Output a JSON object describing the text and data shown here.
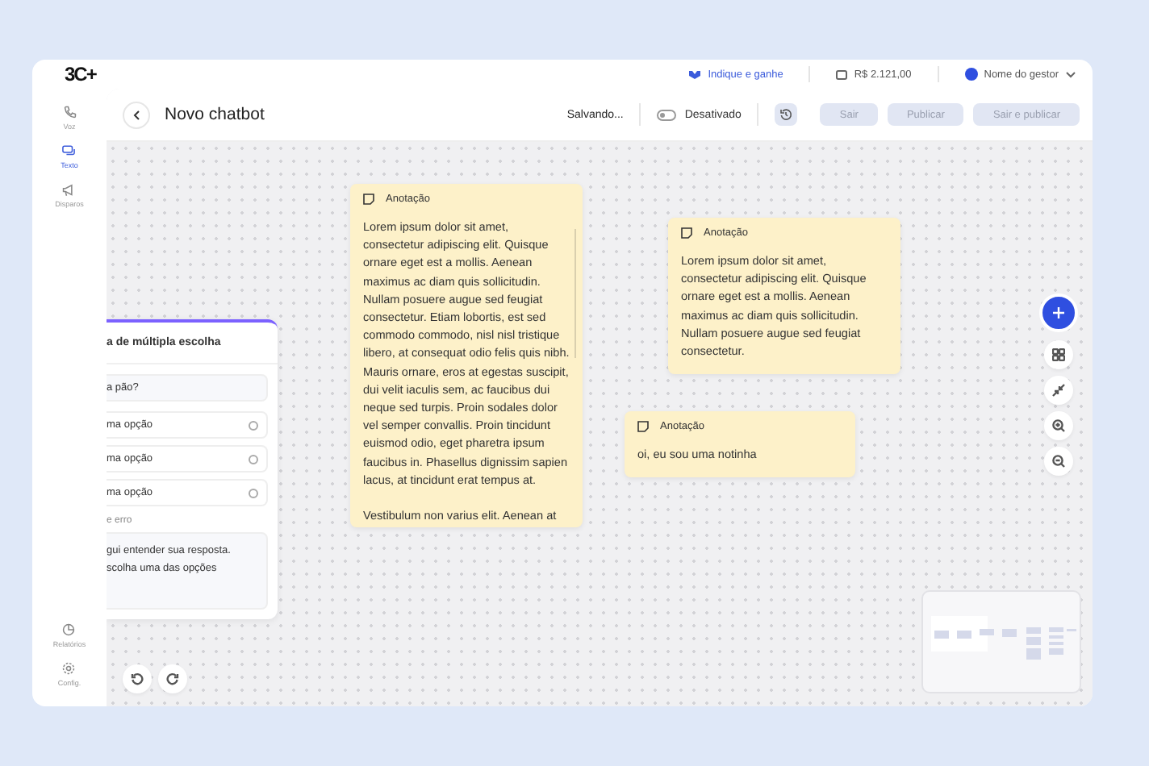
{
  "topbar": {
    "logo": "3C+",
    "referral": "Indique e ganhe",
    "balance": "R$ 2.121,00",
    "user": "Nome do gestor"
  },
  "sidebar": {
    "items": [
      {
        "label": "Voz",
        "selected": false
      },
      {
        "label": "Texto",
        "selected": true
      },
      {
        "label": "Disparos",
        "selected": false
      }
    ],
    "bottom_items": [
      {
        "label": "Relatórios",
        "selected": false
      },
      {
        "label": "Config.",
        "selected": false
      }
    ]
  },
  "header": {
    "title": "Novo chatbot",
    "save_status": "Salvando...",
    "toggle": {
      "label": "Desativado",
      "on": false
    },
    "buttons": [
      {
        "label": "Sair",
        "disabled": true
      },
      {
        "label": "Publicar",
        "disabled": true
      },
      {
        "label": "Sair e publicar",
        "disabled": true
      }
    ]
  },
  "choice_card": {
    "title": "a de múltipla escolha",
    "question": "a pão?",
    "options": [
      {
        "label": "ma opção",
        "selected": false
      },
      {
        "label": "ma opção",
        "selected": false
      },
      {
        "label": "ma opção",
        "selected": false
      }
    ],
    "error_label": "e erro",
    "error_message": "gui entender sua resposta.\nscolha uma das opções"
  },
  "notes": [
    {
      "title": "Anotação",
      "paragraphs": [
        "Lorem ipsum dolor sit amet, consectetur adipiscing elit. Quisque ornare eget est a mollis. Aenean maximus ac diam quis sollicitudin. Nullam posuere augue sed feugiat consectetur. Etiam lobortis, est sed commodo commodo, nisl nisl tristique libero, at consequat odio felis quis nibh. Mauris ornare, eros at egestas suscipit, dui velit iaculis sem, ac faucibus dui neque sed turpis. Proin sodales dolor vel semper convallis. Proin tincidunt euismod odio, eget pharetra ipsum faucibus in. Phasellus dignissim sapien lacus, at tincidunt erat tempus at.",
        "Vestibulum non varius elit. Aenean at"
      ],
      "scrollable": true
    },
    {
      "title": "Anotação",
      "paragraphs": [
        "Lorem ipsum dolor sit amet, consectetur adipiscing elit. Quisque ornare eget est a mollis. Aenean maximus ac diam quis sollicitudin. Nullam posuere augue sed feugiat consectetur."
      ],
      "scrollable": false
    },
    {
      "title": "Anotação",
      "paragraphs": [
        "oi, eu sou uma notinha"
      ],
      "scrollable": false
    }
  ]
}
